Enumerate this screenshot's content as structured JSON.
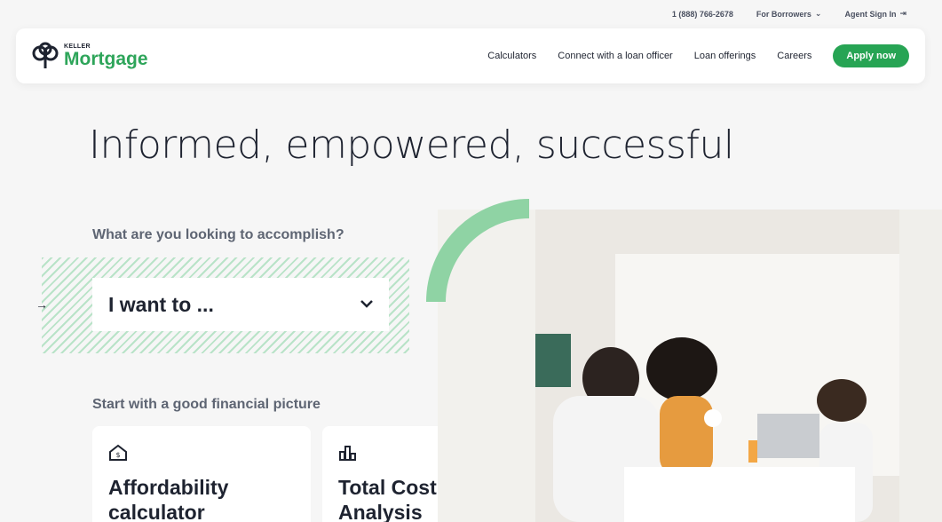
{
  "utility": {
    "phone": "1 (888) 766-2678",
    "borrowers": "For Borrowers",
    "agent": "Agent Sign In"
  },
  "logo": {
    "small": "KELLER",
    "big": "Mortgage"
  },
  "nav": {
    "items": [
      "Calculators",
      "Connect with a loan officer",
      "Loan offerings",
      "Careers"
    ],
    "cta": "Apply now"
  },
  "hero": {
    "title": "Informed, empowered, successful",
    "question": "What are you looking to accomplish?",
    "select_value": "I want to ..."
  },
  "section": {
    "label": "Start with a good financial picture",
    "cards": [
      {
        "icon": "house-dollar-icon",
        "line1": "Affordability",
        "line2": "calculator"
      },
      {
        "icon": "bar-chart-icon",
        "line1": "Total Cost",
        "line2": "Analysis"
      }
    ]
  },
  "colors": {
    "brand_green": "#27a454",
    "light_green": "#8fd3a4"
  }
}
